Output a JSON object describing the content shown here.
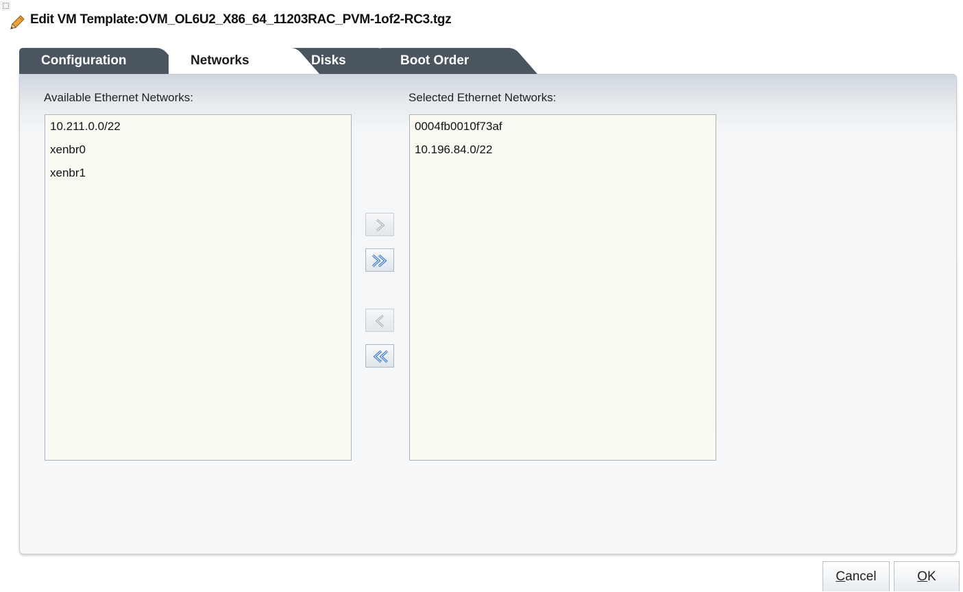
{
  "dialog": {
    "title": "Edit VM Template:OVM_OL6U2_X86_64_11203RAC_PVM-1of2-RC3.tgz"
  },
  "tabs": [
    {
      "label": "Configuration",
      "active": false
    },
    {
      "label": "Networks",
      "active": true
    },
    {
      "label": "Disks",
      "active": false
    },
    {
      "label": "Boot Order",
      "active": false
    }
  ],
  "networks": {
    "available_label": "Available Ethernet Networks:",
    "selected_label": "Selected Ethernet Networks:",
    "available": [
      "10.211.0.0/22",
      "xenbr0",
      "xenbr1"
    ],
    "selected": [
      "0004fb0010f73af",
      "10.196.84.0/22"
    ]
  },
  "shuttle": {
    "move_icon": "chevron-right-icon",
    "move_all_icon": "double-chevron-right-icon",
    "remove_icon": "chevron-left-icon",
    "remove_all_icon": "double-chevron-left-icon"
  },
  "footer": {
    "cancel_first": "C",
    "cancel_rest": "ancel",
    "ok_first": "O",
    "ok_rest": "K"
  },
  "colors": {
    "tab_inactive": "#4a5560",
    "tab_active": "#ffffff",
    "list_background": "#fbfaf2",
    "shuttle_blue": "#2a6fd6",
    "shuttle_gray": "#9aa3ab"
  }
}
